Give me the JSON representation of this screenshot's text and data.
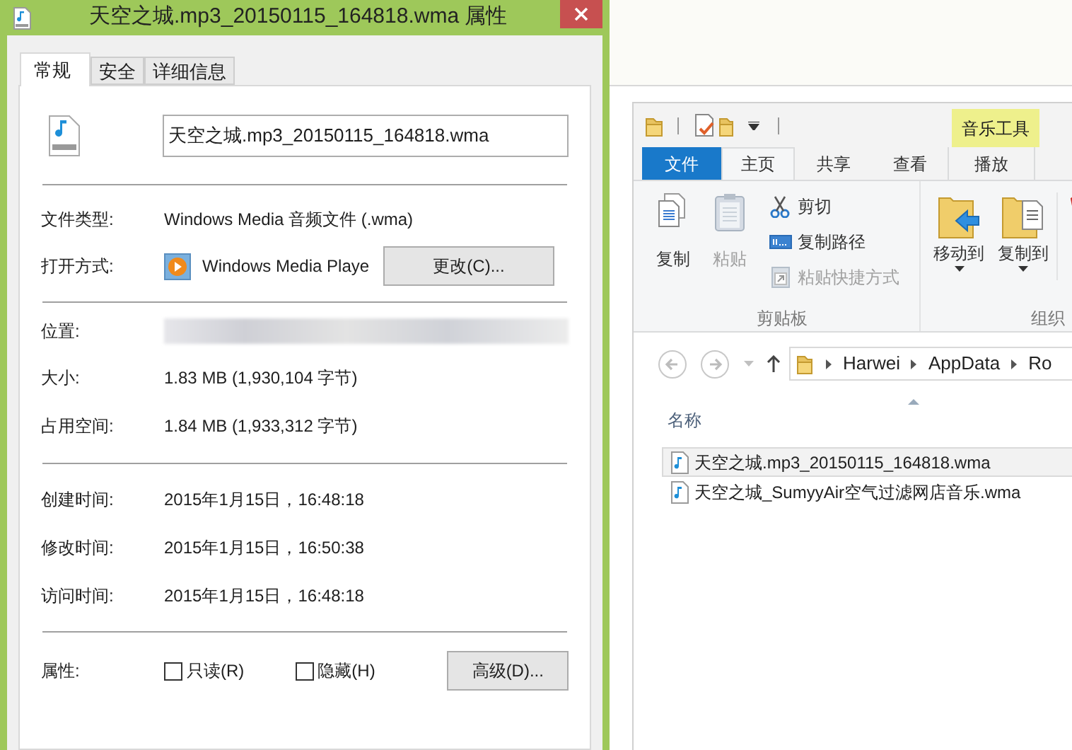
{
  "properties_dialog": {
    "title": "天空之城.mp3_20150115_164818.wma 属性",
    "tabs": [
      {
        "label": "常规",
        "selected": true
      },
      {
        "label": "安全",
        "selected": false
      },
      {
        "label": "详细信息",
        "selected": false
      }
    ],
    "file_name": "天空之城.mp3_20150115_164818.wma",
    "type_row": {
      "label": "文件类型:",
      "value": "Windows Media 音频文件 (.wma)"
    },
    "open_with": {
      "label": "打开方式:",
      "app": "Windows Media Playe",
      "button": "更改(C)..."
    },
    "location": {
      "label": "位置:"
    },
    "size_rows": [
      {
        "label": "大小:",
        "value": "1.83 MB (1,930,104 字节)"
      },
      {
        "label": "占用空间:",
        "value": "1.84 MB (1,933,312 字节)"
      }
    ],
    "time_rows": [
      {
        "label": "创建时间:",
        "value": "2015年1月15日，16:48:18"
      },
      {
        "label": "修改时间:",
        "value": "2015年1月15日，16:50:38"
      },
      {
        "label": "访问时间:",
        "value": "2015年1月15日，16:48:18"
      }
    ],
    "attributes": {
      "label": "属性:",
      "checkboxes": [
        {
          "label": "只读(R)",
          "checked": false
        },
        {
          "label": "隐藏(H)",
          "checked": false
        }
      ],
      "button": "高级(D)..."
    }
  },
  "explorer": {
    "contextual_group": "音乐工具",
    "ribbon_tabs": [
      {
        "label": "文件",
        "kind": "file",
        "selected": false
      },
      {
        "label": "主页",
        "kind": "normal",
        "selected": true
      },
      {
        "label": "共享",
        "kind": "normal",
        "selected": false
      },
      {
        "label": "查看",
        "kind": "normal",
        "selected": false
      },
      {
        "label": "播放",
        "kind": "contextual",
        "selected": false
      }
    ],
    "clipboard": {
      "label": "剪贴板",
      "large_buttons": [
        {
          "label": "复制",
          "disabled": false
        },
        {
          "label": "粘贴",
          "disabled": true
        }
      ],
      "small_buttons": [
        {
          "label": "剪切",
          "disabled": false
        },
        {
          "label": "复制路径",
          "disabled": false
        },
        {
          "label": "粘贴快捷方式",
          "disabled": true
        }
      ]
    },
    "organize": {
      "label": "组织",
      "buttons": [
        {
          "label": "移动到",
          "kind": "move"
        },
        {
          "label": "复制到",
          "kind": "copy"
        }
      ]
    },
    "breadcrumbs": [
      "Harwei",
      "AppData",
      "Ro"
    ],
    "column": "名称",
    "files": [
      {
        "name": "天空之城.mp3_20150115_164818.wma",
        "selected": true
      },
      {
        "name": "天空之城_SumyyAir空气过滤网店音乐.wma",
        "selected": false
      }
    ]
  }
}
